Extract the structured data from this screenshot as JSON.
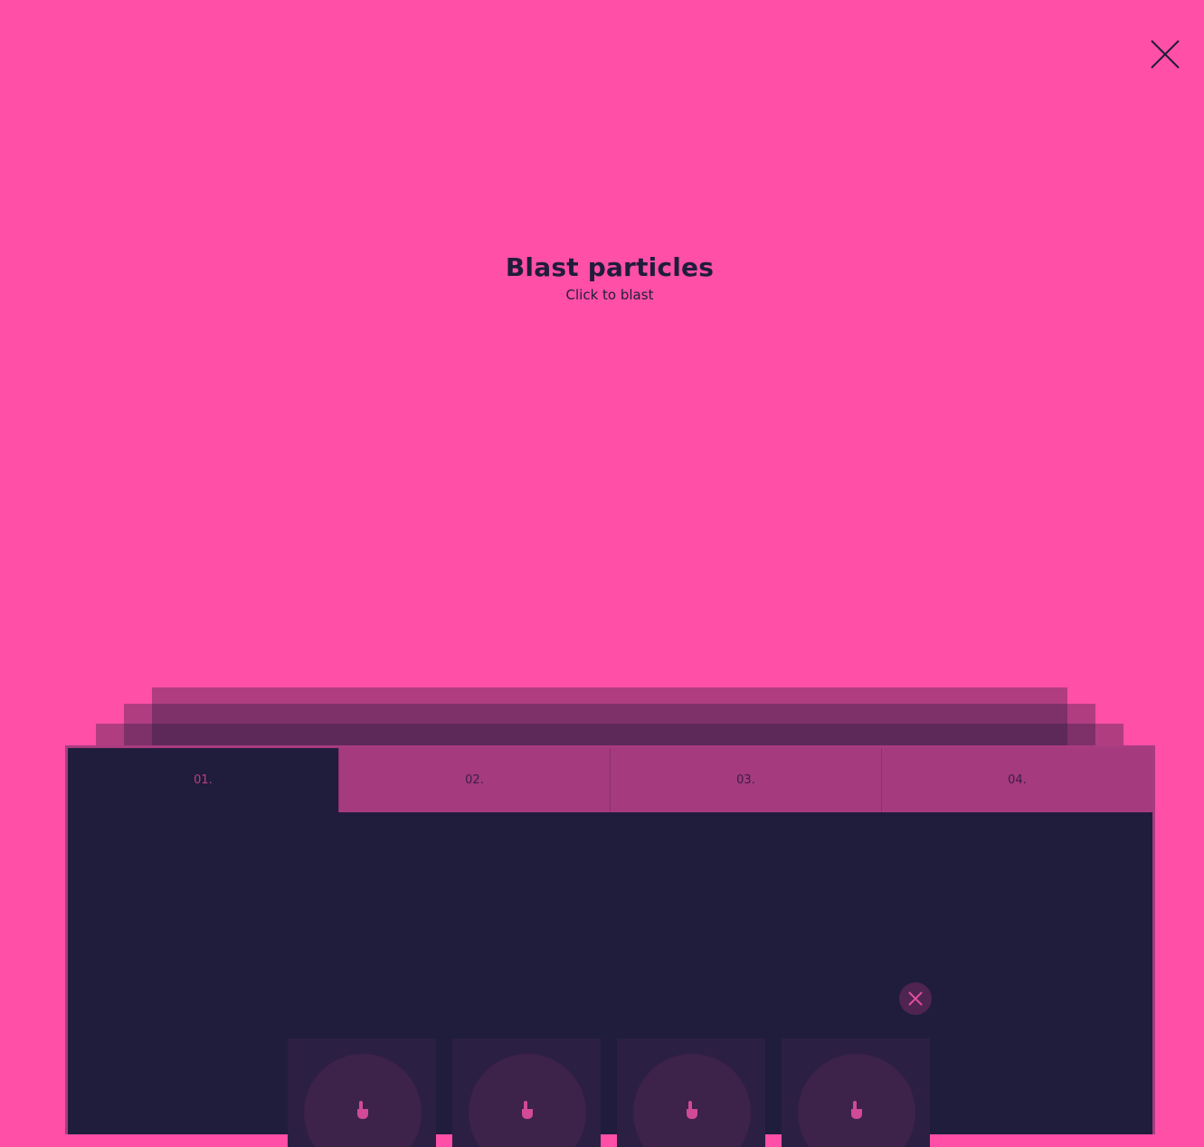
{
  "header": {
    "close_icon": "close-icon"
  },
  "hero": {
    "title": "Blast particles",
    "subtitle": "Click to blast"
  },
  "panel": {
    "tabs": [
      {
        "label": "01.",
        "active": true
      },
      {
        "label": "02.",
        "active": false
      },
      {
        "label": "03.",
        "active": false
      },
      {
        "label": "04.",
        "active": false
      }
    ],
    "close_icon": "close-icon",
    "cards": [
      {
        "icon": "tap-hand-icon"
      },
      {
        "icon": "tap-hand-icon"
      },
      {
        "icon": "tap-hand-icon"
      },
      {
        "icon": "tap-hand-icon"
      }
    ]
  },
  "colors": {
    "background": "#ff4fa6",
    "dark": "#1f1d3b",
    "tab_inactive": "#a53a7e",
    "accent": "#e0509c"
  }
}
